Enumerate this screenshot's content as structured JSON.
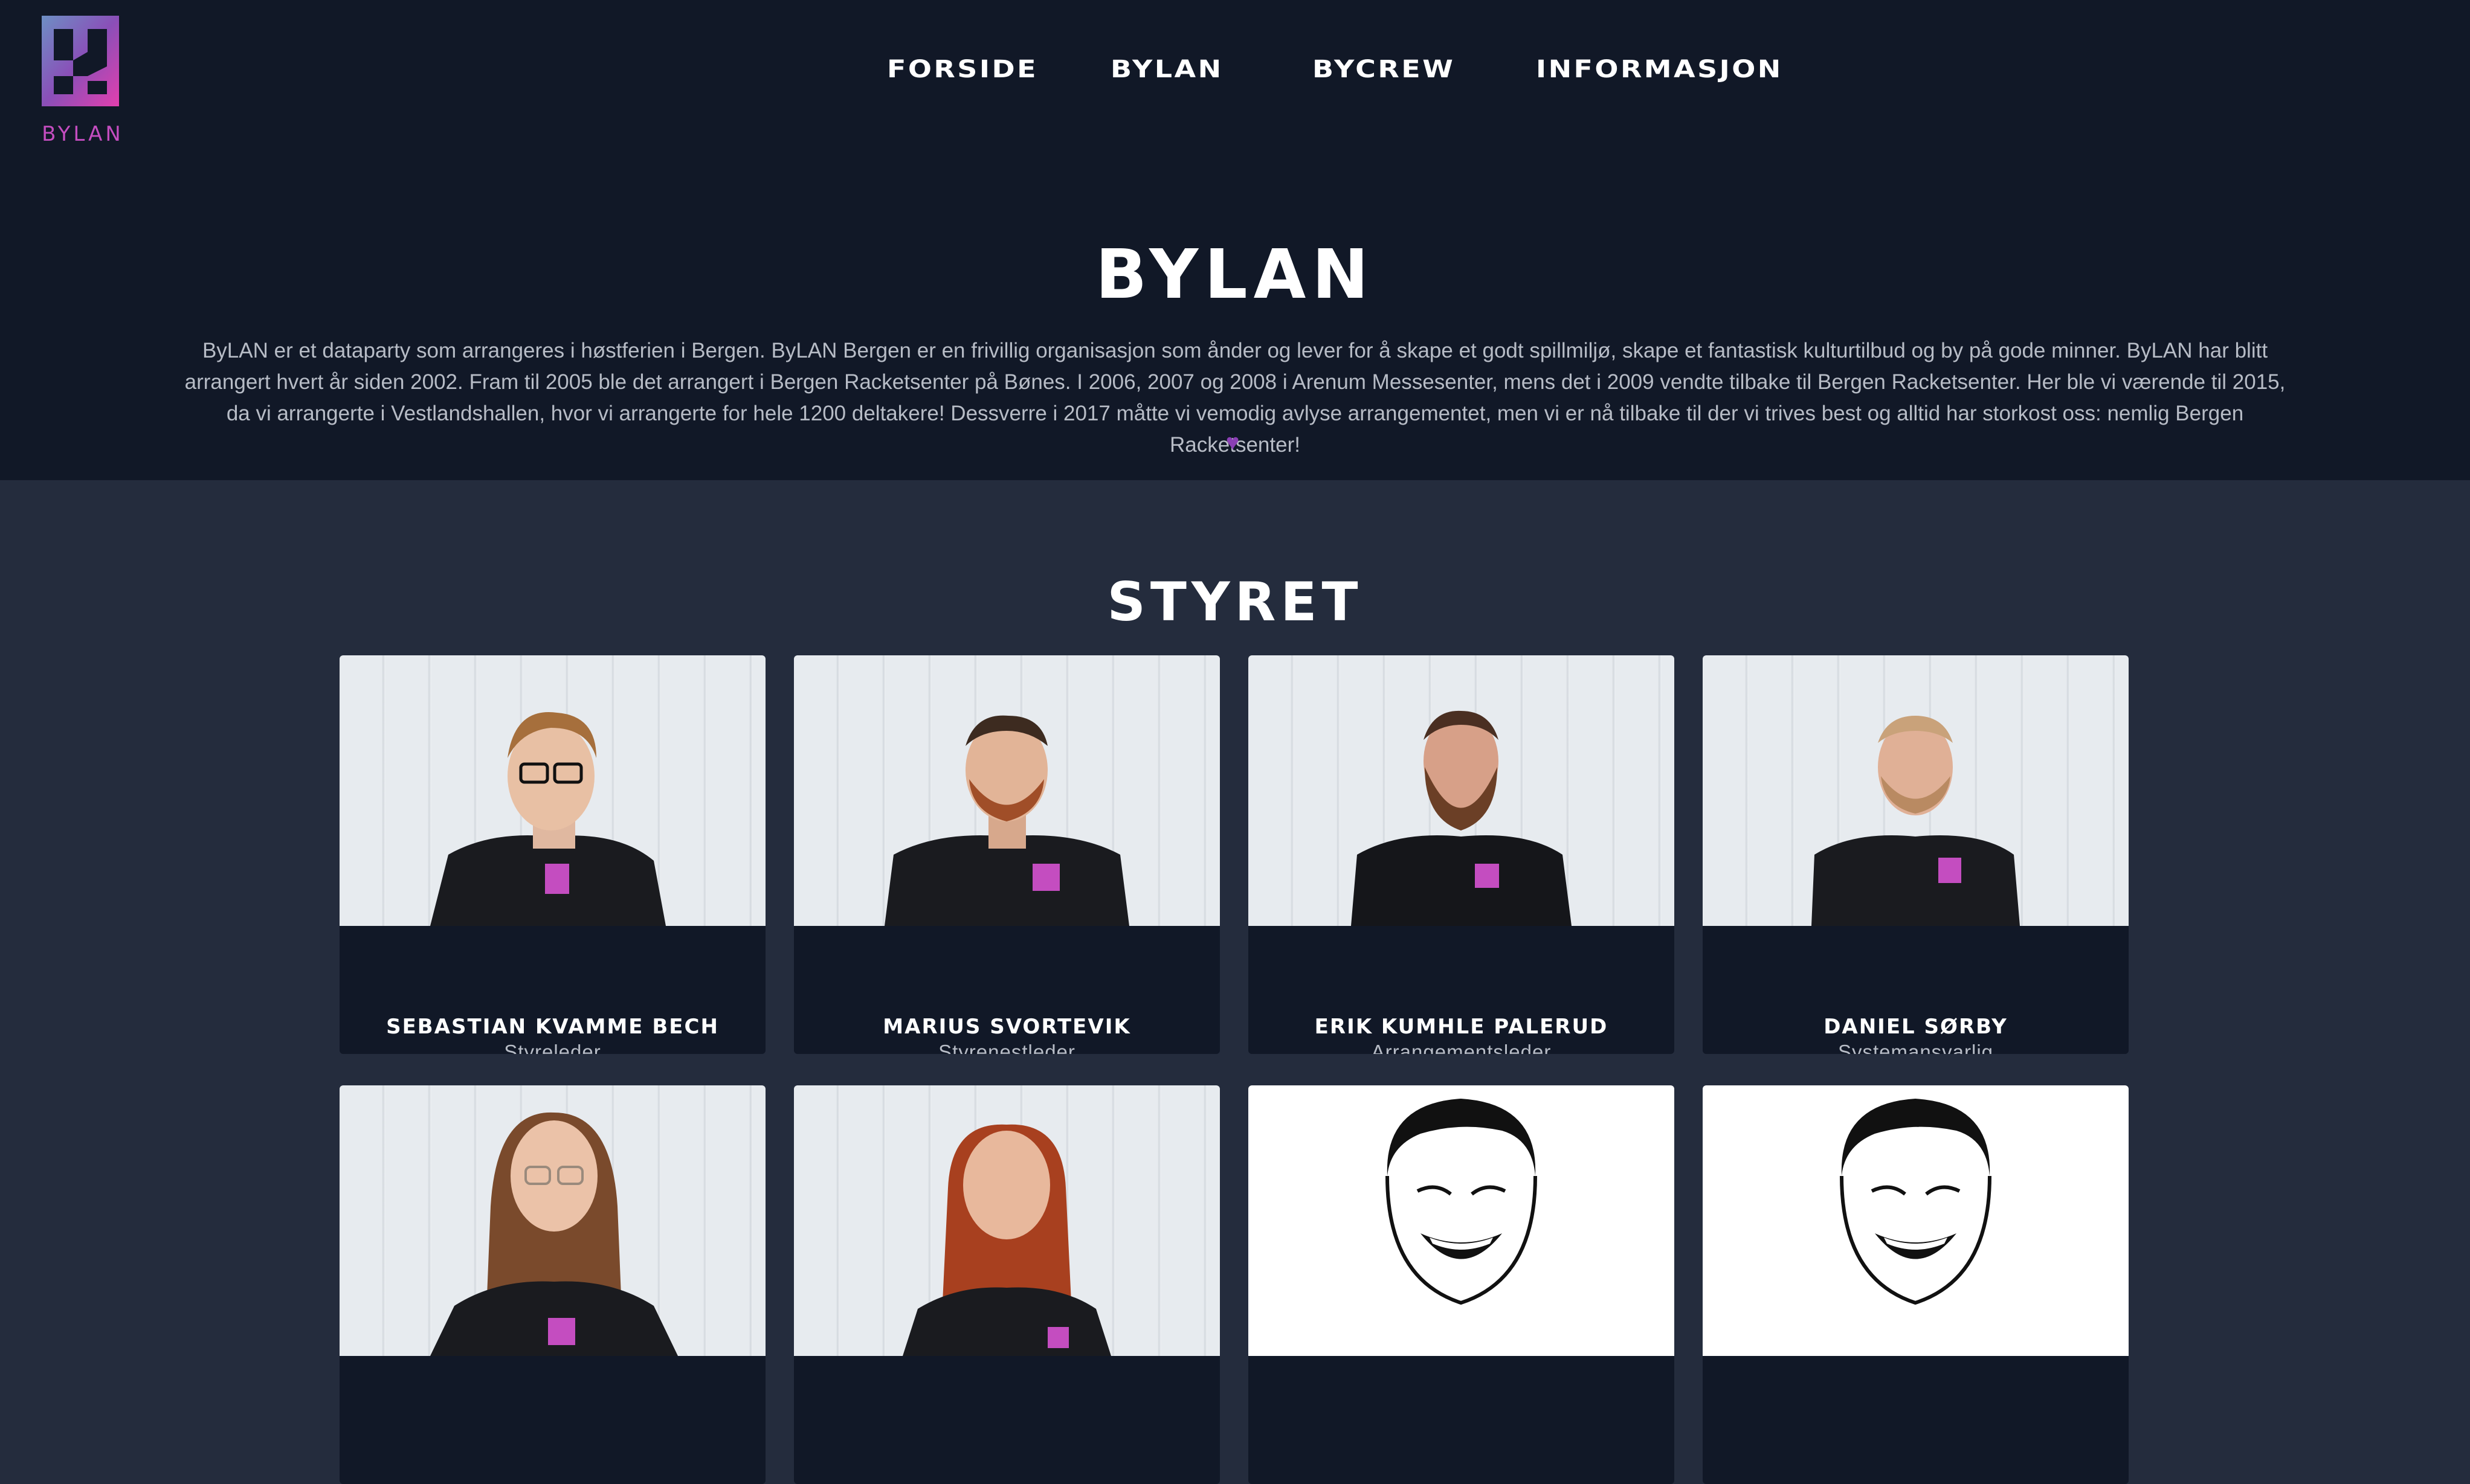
{
  "logo": {
    "text": "BYLAN"
  },
  "nav": {
    "items": [
      "FORSIDE",
      "BYLAN",
      "BYCREW",
      "INFORMASJON"
    ]
  },
  "hero": {
    "title": "BYLAN",
    "text": "ByLAN er et dataparty som arrangeres i høstferien i Bergen. ByLAN Bergen er en frivillig organisasjon som ånder og lever for å skape et godt spillmiljø, skape et fantastisk kulturtilbud og by på gode minner. ByLAN har blitt arrangert hvert år siden 2002. Fram til 2005 ble det arrangert i Bergen Racketsenter på Bønes. I 2006, 2007 og 2008 i Arenum Messesenter, mens det i 2009 vendte tilbake til Bergen Racketsenter. Her ble vi værende til 2015, da vi arrangerte i Vestlandshallen, hvor vi arrangerte for hele 1200 deltakere! Dessverre i 2017 måtte vi vemodig avlyse arrangementet, men vi er nå tilbake til der vi trives best og alltid har storkost oss: nemlig Bergen Racketsenter!",
    "heart": "♥"
  },
  "styret": {
    "title": "STYRET",
    "members": [
      {
        "name": "SEBASTIAN KVAMME BECH",
        "role": "Styreleder"
      },
      {
        "name": "MARIUS SVORTEVIK",
        "role": "Styrenestleder"
      },
      {
        "name": "ERIK KUMHLE PALERUD",
        "role": "Arrangementsleder"
      },
      {
        "name": "DANIEL SØRBY",
        "role": "Systemansvarlig"
      }
    ]
  },
  "colors": {
    "header_bg": "#111827",
    "page_bg": "#242c3d",
    "accent": "#c44dc0",
    "heart": "#8b3fb5"
  }
}
